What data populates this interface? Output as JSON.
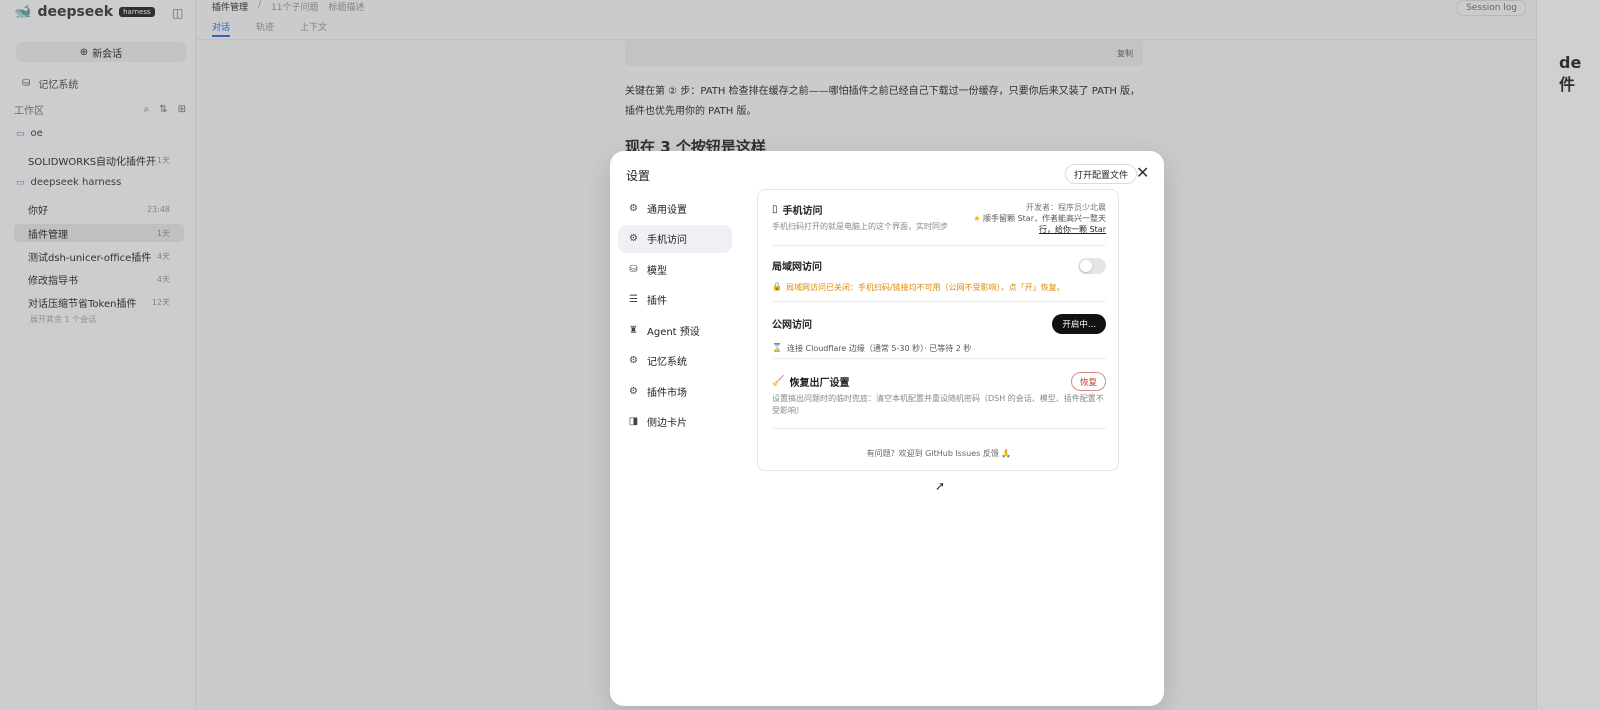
{
  "sidebar": {
    "brand": "deepseek",
    "badge": "harness",
    "new_chat": "新会话",
    "memory": "记忆系统",
    "workspace_label": "工作区",
    "projects": [
      {
        "name": "oe",
        "sessions": [
          {
            "title": "SOLIDWORKS自动化插件开发",
            "meta": "1天"
          }
        ]
      },
      {
        "name": "deepseek harness",
        "sessions": [
          {
            "title": "你好",
            "meta": "23:48",
            "active": false
          },
          {
            "title": "插件管理",
            "meta": "1天",
            "active": true
          },
          {
            "title": "测试dsh-unicer-office插件",
            "meta": "4天",
            "active": false
          },
          {
            "title": "修改指导书",
            "meta": "4天",
            "active": false
          },
          {
            "title": "对话压缩节省Token插件",
            "meta": "12天",
            "active": false
          }
        ]
      }
    ],
    "more": "展开其余 1 个会话"
  },
  "topbar": {
    "crumbs": [
      "插件管理",
      "/",
      "11个子问题",
      "标题描述"
    ],
    "tabs": [
      "对话",
      "轨迹",
      "上下文"
    ],
    "session_log": "Session log"
  },
  "document": {
    "copy": "复制",
    "para": "关键在第 ② 步：PATH 检查排在缓存之前——哪怕插件之前已经自己下载过一份缓存，只要你后来又装了 PATH 版，插件也优先用你的 PATH 版。",
    "heading": "现在 3 个按钮是这样"
  },
  "right_panel": {
    "title": "de 件"
  },
  "modal": {
    "title": "设置",
    "open_config": "打开配置文件",
    "close": "✕",
    "nav": [
      {
        "label": "通用设置",
        "icon": "⚙",
        "active": false
      },
      {
        "label": "手机访问",
        "icon": "⚙",
        "active": true
      },
      {
        "label": "模型",
        "icon": "⛁",
        "active": false
      },
      {
        "label": "插件",
        "icon": "☰",
        "active": false
      },
      {
        "label": "Agent 预设",
        "icon": "♜",
        "active": false
      },
      {
        "label": "记忆系统",
        "icon": "⚙",
        "active": false
      },
      {
        "label": "插件市场",
        "icon": "⚙",
        "active": false
      },
      {
        "label": "侧边卡片",
        "icon": "◨",
        "active": false
      }
    ],
    "mobile": {
      "title": "手机访问",
      "desc": "手机扫码打开的就是电脑上的这个界面，实时同步",
      "dev_line": "开发者：程序员少北晨",
      "star_text": "顺手留颗 Star，作者能高兴一整天",
      "star_link": "行，给你一颗 Star"
    },
    "lan": {
      "title": "局域网访问",
      "warning": "局域网访问已关闭：手机扫码/链接均不可用（公网不受影响），点「开」恢复。",
      "enabled": false
    },
    "public": {
      "title": "公网访问",
      "button": "开启中...",
      "status": "连接 Cloudflare 边缘（通常 5-30 秒）· 已等待 2 秒"
    },
    "reset": {
      "title": "恢复出厂设置",
      "button": "恢复",
      "desc": "设置搞出问题时的临时兜底：清空本机配置并重设随机密码（DSH 的会话、模型、插件配置不受影响）"
    },
    "footer": "有问题？欢迎到 GitHub Issues 反馈 🙏"
  }
}
